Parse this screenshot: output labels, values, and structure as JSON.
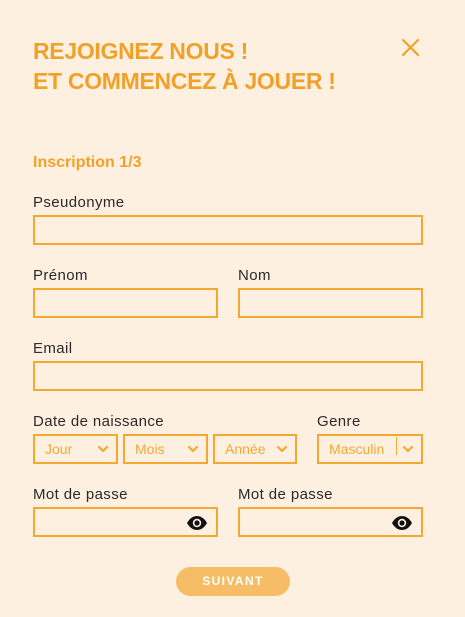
{
  "header": {
    "title_line1": "REJOIGNEZ NOUS !",
    "title_line2": "ET COMMENCEZ À JOUER !",
    "close_icon": "close-icon"
  },
  "form": {
    "step": "Inscription 1/3",
    "pseudonyme_label": "Pseudonyme",
    "pseudonyme_value": "",
    "prenom_label": "Prénom",
    "prenom_value": "",
    "nom_label": "Nom",
    "nom_value": "",
    "email_label": "Email",
    "email_value": "",
    "birthdate_label": "Date de naissance",
    "day_select": "Jour",
    "month_select": "Mois",
    "year_select": "Année",
    "gender_label": "Genre",
    "gender_select": "Masculin",
    "password_label": "Mot de passe",
    "password_confirm_label": "Mot de passe",
    "password_value": "",
    "password_confirm_value": "",
    "password_toggle_icon": "eye-icon"
  },
  "actions": {
    "next_label": "SUIVANT"
  },
  "colors": {
    "accent": "#f2a128",
    "field_border": "#f3a931",
    "background": "#fdf0e1",
    "button": "#f7bd66",
    "text": "#2a2a2a"
  }
}
